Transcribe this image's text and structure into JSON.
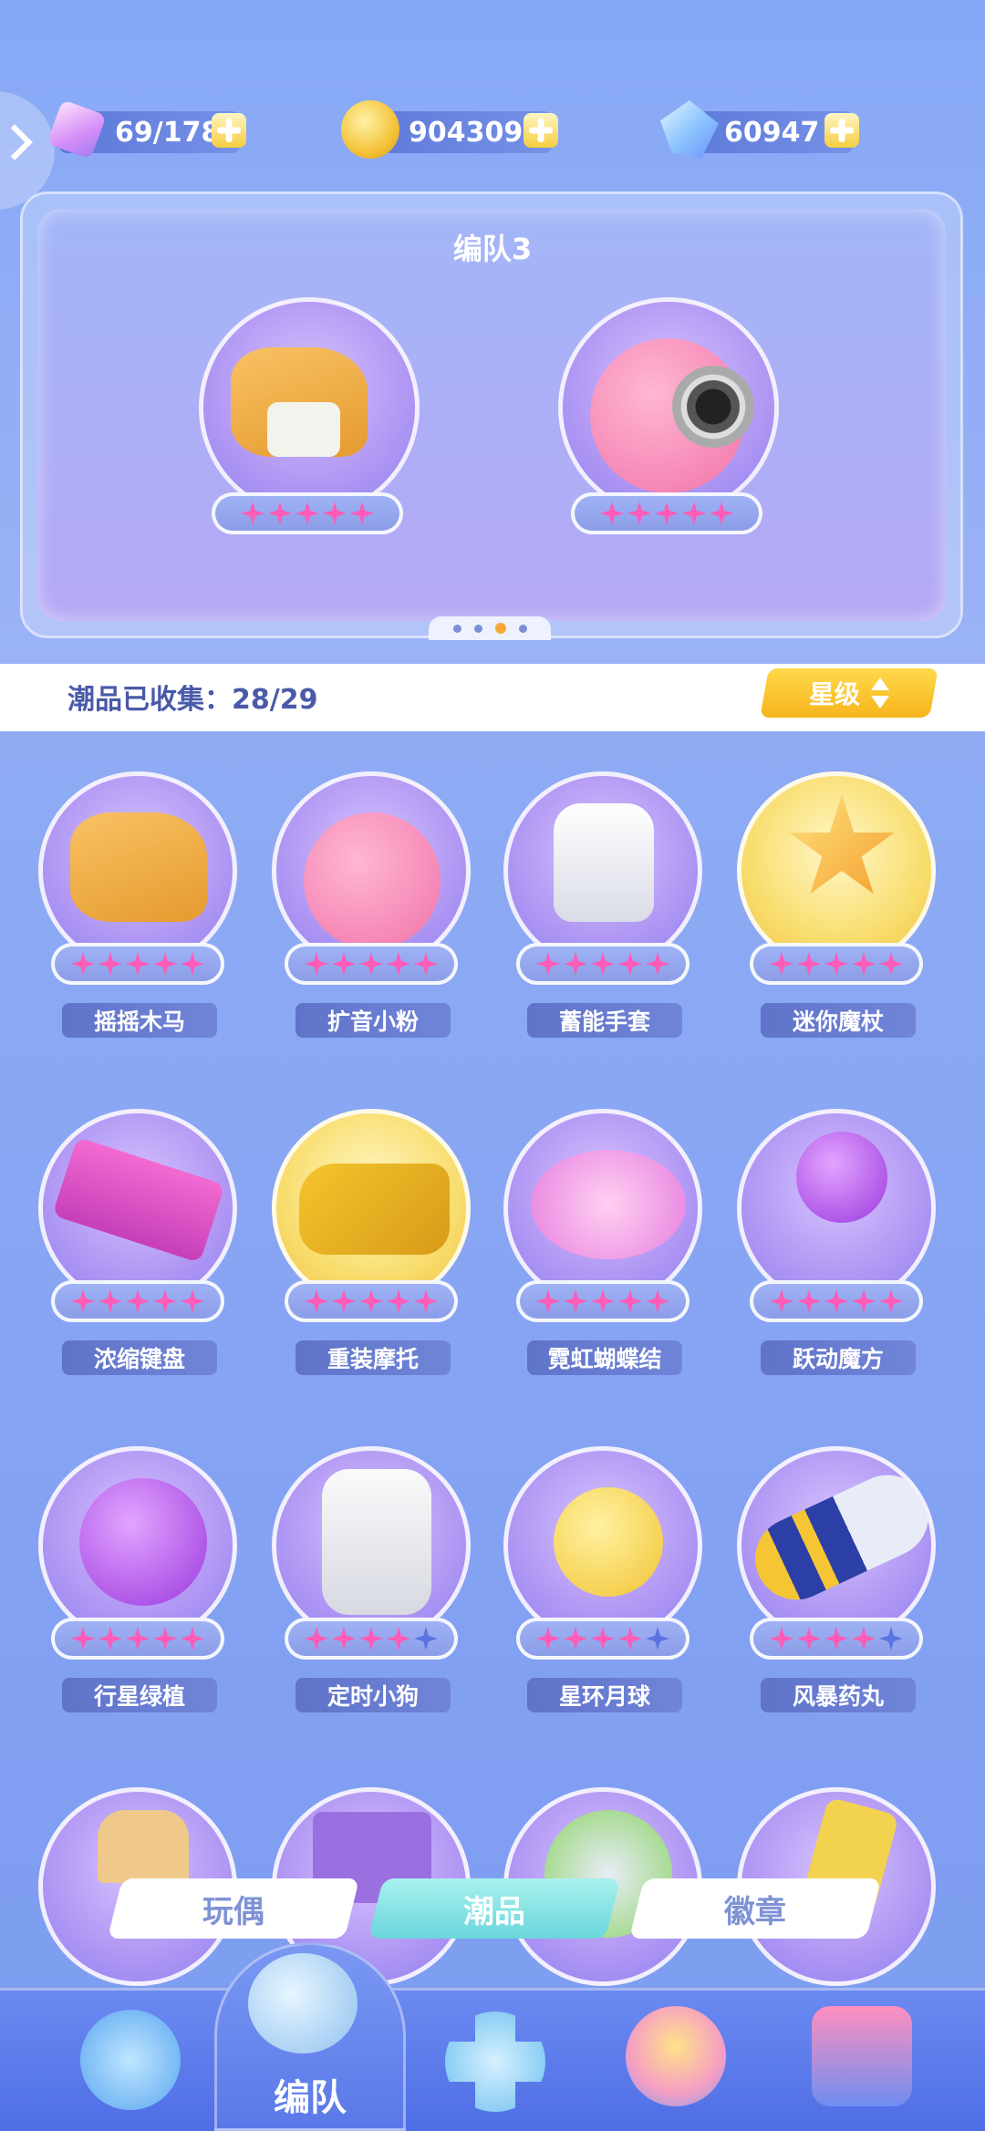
{
  "resources": [
    {
      "name": "energy",
      "value": "69/178",
      "icon": "energy-icon"
    },
    {
      "name": "coin",
      "value": "904309",
      "icon": "coin-icon"
    },
    {
      "name": "gem",
      "value": "60947",
      "icon": "gem-icon"
    }
  ],
  "team": {
    "title": "编队3",
    "members": [
      {
        "name": "rocking-horse",
        "stars": 5
      },
      {
        "name": "pink-speaker",
        "stars": 5
      }
    ],
    "page_count": 4,
    "current_page": 3
  },
  "collection": {
    "label": "潮品已收集：28/29",
    "sort_label": "星级"
  },
  "items": [
    {
      "label": "摇摇木马",
      "stars_filled": 5,
      "stars_total": 5
    },
    {
      "label": "扩音小粉",
      "stars_filled": 5,
      "stars_total": 5
    },
    {
      "label": "蓄能手套",
      "stars_filled": 5,
      "stars_total": 5
    },
    {
      "label": "迷你魔杖",
      "stars_filled": 5,
      "stars_total": 5
    },
    {
      "label": "浓缩键盘",
      "stars_filled": 5,
      "stars_total": 5
    },
    {
      "label": "重装摩托",
      "stars_filled": 5,
      "stars_total": 5
    },
    {
      "label": "霓虹蝴蝶结",
      "stars_filled": 5,
      "stars_total": 5
    },
    {
      "label": "跃动魔方",
      "stars_filled": 5,
      "stars_total": 5
    },
    {
      "label": "行星绿植",
      "stars_filled": 5,
      "stars_total": 5
    },
    {
      "label": "定时小狗",
      "stars_filled": 4,
      "stars_total": 5
    },
    {
      "label": "星环月球",
      "stars_filled": 4,
      "stars_total": 5
    },
    {
      "label": "风暴药丸",
      "stars_filled": 4,
      "stars_total": 5
    }
  ],
  "tabs": [
    {
      "label": "玩偶",
      "active": false
    },
    {
      "label": "潮品",
      "active": true
    },
    {
      "label": "徽章",
      "active": false
    }
  ],
  "nav": {
    "center_label": "编队"
  },
  "colors": {
    "accent": "#f7b51d",
    "star_pink": "#ff5bb7",
    "bg": "#7ea4f3"
  }
}
